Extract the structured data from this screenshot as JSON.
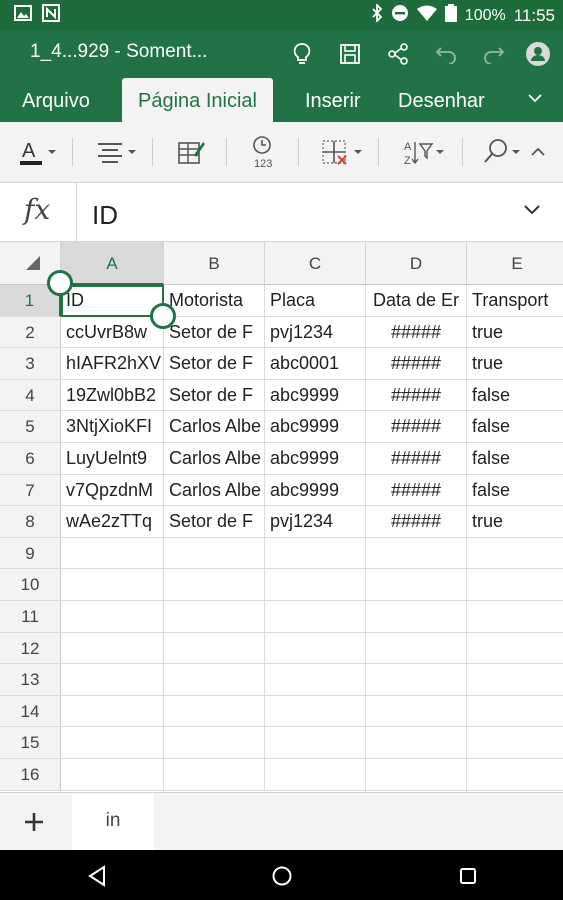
{
  "status_bar": {
    "battery": "100%",
    "time": "11:55",
    "icons": [
      "photo-icon",
      "n-icon",
      "bluetooth-icon",
      "dnd-icon",
      "wifi-icon",
      "battery-icon"
    ]
  },
  "title_bar": {
    "doc_title": "1_4...929 - Soment...",
    "icons": [
      "lightbulb-icon",
      "save-icon",
      "share-icon",
      "undo-icon",
      "redo-icon",
      "account-icon"
    ]
  },
  "tabs": [
    {
      "label": "Arquivo",
      "active": false
    },
    {
      "label": "Página Inicial",
      "active": true
    },
    {
      "label": "Inserir",
      "active": false
    },
    {
      "label": "Desenhar",
      "active": false
    }
  ],
  "ribbon": {
    "icons": [
      "font-color-icon",
      "align-icon",
      "format-cells-icon",
      "number-format-icon",
      "borders-icon",
      "sort-filter-icon",
      "find-icon",
      "collapse-ribbon-icon"
    ],
    "number_format_label": "123",
    "font_color_label": "A"
  },
  "formula_bar": {
    "fx_label": "fx",
    "value": "ID"
  },
  "grid": {
    "columns": [
      "A",
      "B",
      "C",
      "D",
      "E"
    ],
    "selected_column": "A",
    "selected_row": "1",
    "row_numbers": [
      "1",
      "2",
      "3",
      "4",
      "5",
      "6",
      "7",
      "8",
      "9",
      "10",
      "11",
      "12",
      "13",
      "14",
      "15",
      "16"
    ],
    "rows": [
      [
        "ID",
        "Motorista",
        "Placa",
        "Data de Er",
        "Transport"
      ],
      [
        "ccUvrB8w",
        "Setor de F",
        "pvj1234",
        "#####",
        "true"
      ],
      [
        "hIAFR2hXV",
        "Setor de F",
        "abc0001",
        "#####",
        "true"
      ],
      [
        "19Zwl0bB2",
        "Setor de F",
        "abc9999",
        "#####",
        "false"
      ],
      [
        "3NtjXioKFI",
        "Carlos Albe",
        "abc9999",
        "#####",
        "false"
      ],
      [
        "LuyUelnt9",
        "Carlos Albe",
        "abc9999",
        "#####",
        "false"
      ],
      [
        "v7QpzdnM",
        "Carlos Albe",
        "abc9999",
        "#####",
        "false"
      ],
      [
        "wAe2zTTq",
        "Setor de F",
        "pvj1234",
        "#####",
        "true"
      ]
    ]
  },
  "sheets": {
    "add_label": "+",
    "tabs": [
      "in"
    ]
  },
  "colors": {
    "excel_green": "#217346",
    "status_green": "#1e6b3b",
    "ribbon_bg": "#f3f3f3"
  }
}
